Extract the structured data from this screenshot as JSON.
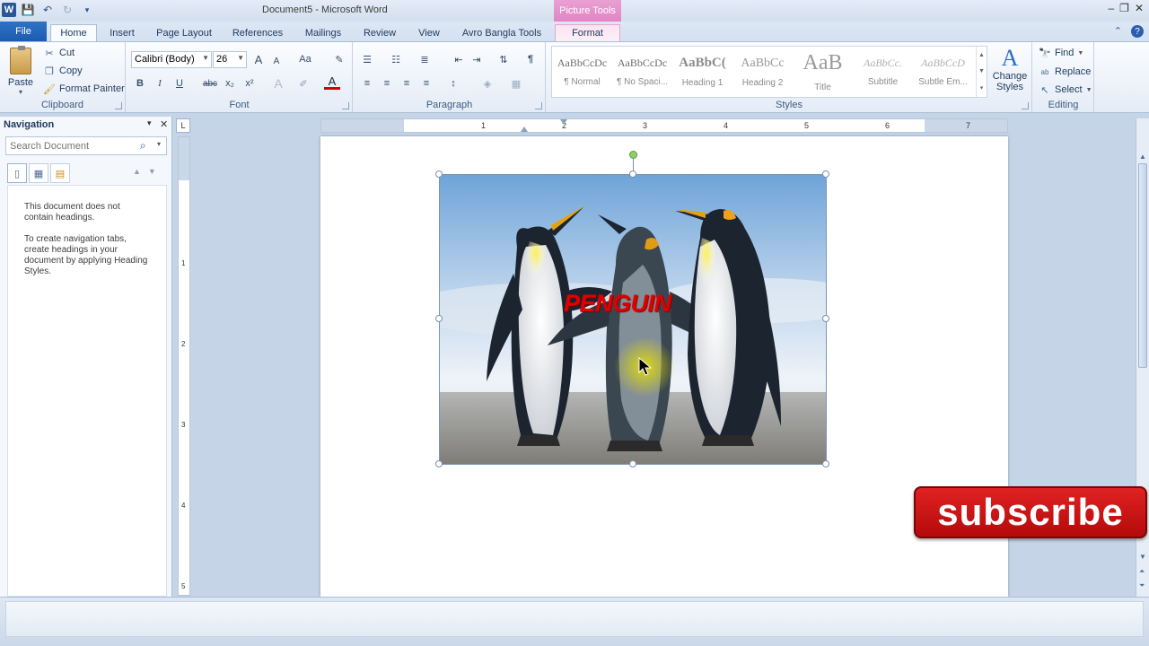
{
  "window": {
    "title": "Document5 - Microsoft Word",
    "context_tab_header": "Picture Tools",
    "minimize_glyph": "–",
    "restore_glyph": "❐",
    "close_glyph": "✕"
  },
  "qat": {
    "app_icon": "W",
    "save_icon": "💾",
    "undo_icon": "↶",
    "redo_icon": "↻",
    "customize_icon": "▾"
  },
  "tabs": [
    "File",
    "Home",
    "Insert",
    "Page Layout",
    "References",
    "Mailings",
    "Review",
    "View",
    "Avro Bangla Tools",
    "Format"
  ],
  "ribbon_help": {
    "minimize_glyph": "⌃",
    "help_glyph": "?"
  },
  "clipboard": {
    "label": "Clipboard",
    "paste": "Paste",
    "cut": "Cut",
    "copy": "Copy",
    "format_painter": "Format Painter"
  },
  "font": {
    "label": "Font",
    "family": "Calibri (Body)",
    "size": "26",
    "tool_glyphs": {
      "grow": "A",
      "shrink": "A",
      "change_case": "Aa",
      "clear": "✎",
      "bold": "B",
      "italic": "I",
      "underline": "U",
      "strike": "abc",
      "subscript": "x₂",
      "superscript": "x²",
      "effects": "A",
      "highlight": "✐",
      "color": "A"
    }
  },
  "paragraph": {
    "label": "Paragraph",
    "tool_glyphs": {
      "bullets": "☰",
      "numbering": "☷",
      "multilevel": "≣",
      "decrease_indent": "⇤",
      "increase_indent": "⇥",
      "sort": "⇅",
      "pilcrow": "¶",
      "align_left": "≡",
      "center": "≡",
      "align_right": "≡",
      "justify": "≡",
      "line_spacing": "↕",
      "shading": "◈",
      "borders": "▦"
    }
  },
  "styles": {
    "label": "Styles",
    "items": [
      {
        "sample": "AaBbCcDc",
        "name": "¶ Normal"
      },
      {
        "sample": "AaBbCcDc",
        "name": "¶ No Spaci..."
      },
      {
        "sample": "AaBbC(",
        "name": "Heading 1"
      },
      {
        "sample": "AaBbCc",
        "name": "Heading 2"
      },
      {
        "sample": "AaB",
        "name": "Title"
      },
      {
        "sample": "AaBbCc.",
        "name": "Subtitle"
      },
      {
        "sample": "AaBbCcD",
        "name": "Subtle Em..."
      }
    ],
    "change_styles": "Change Styles",
    "change_styles_icon": "A"
  },
  "editing": {
    "label": "Editing",
    "find": "Find",
    "find_icon": "🔭",
    "replace": "Replace",
    "replace_icon": "ab",
    "select": "Select",
    "select_icon": "↖"
  },
  "navigation": {
    "title": "Navigation",
    "search_placeholder": "Search Document",
    "search_icon": "⌕",
    "search_dropdown_glyph": "▾",
    "options_glyph": "▾",
    "close_glyph": "✕",
    "tab_icons": {
      "headings": "▯",
      "pages": "▦",
      "results": "▤"
    },
    "prev_glyph": "▲",
    "next_glyph": "▼",
    "message_1": "This document does not contain headings.",
    "message_2": "To create navigation tabs, create headings in your document by applying Heading Styles."
  },
  "ruler": {
    "corner_glyph": "L",
    "numbers": [
      "1",
      "2",
      "3",
      "4",
      "5",
      "6",
      "7"
    ],
    "vertical_numbers": [
      "1",
      "2",
      "3",
      "4",
      "5"
    ]
  },
  "document": {
    "picture_caption": "PENGUIN"
  },
  "scrollbar": {
    "up_glyph": "▲",
    "down_glyph": "▼"
  },
  "overlay": {
    "subscribe": "subscribe"
  },
  "colors": {
    "accent": "#2b5797",
    "file_tab": "#1b5cb0",
    "picture_tools": "#e284c4",
    "subscribe_red": "#d21616",
    "caption_red": "#e00000"
  }
}
